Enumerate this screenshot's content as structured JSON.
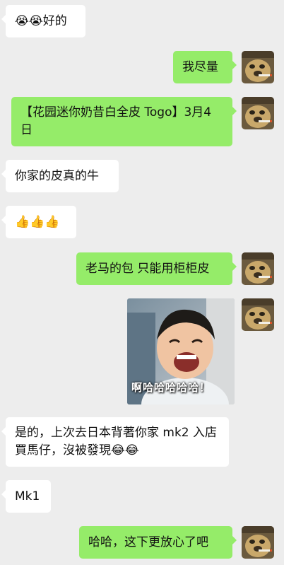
{
  "messages": [
    {
      "side": "left",
      "text": "😭😭好的"
    },
    {
      "side": "right",
      "text": "我尽量"
    },
    {
      "side": "right",
      "text": "【花园迷你奶昔白全皮 Togo】3月4日"
    },
    {
      "side": "left",
      "text": "你家的皮真的牛"
    },
    {
      "side": "left",
      "text": "👍👍👍"
    },
    {
      "side": "right",
      "text": "老马的包 只能用柜柜皮"
    },
    {
      "side": "right",
      "type": "image",
      "caption": "啊哈哈哈哈哈！"
    },
    {
      "side": "left",
      "text": "是的，上次去日本背著你家 mk2 入店買馬仔，沒被發現😂😂"
    },
    {
      "side": "left",
      "text": "Mk1"
    },
    {
      "side": "right",
      "text": "哈哈，这下更放心了吧"
    }
  ],
  "colors": {
    "background": "#ededed",
    "left_bubble": "#ffffff",
    "right_bubble": "#95ec69"
  },
  "icons": {
    "avatar": "avatar-dog-with-cigarette"
  }
}
